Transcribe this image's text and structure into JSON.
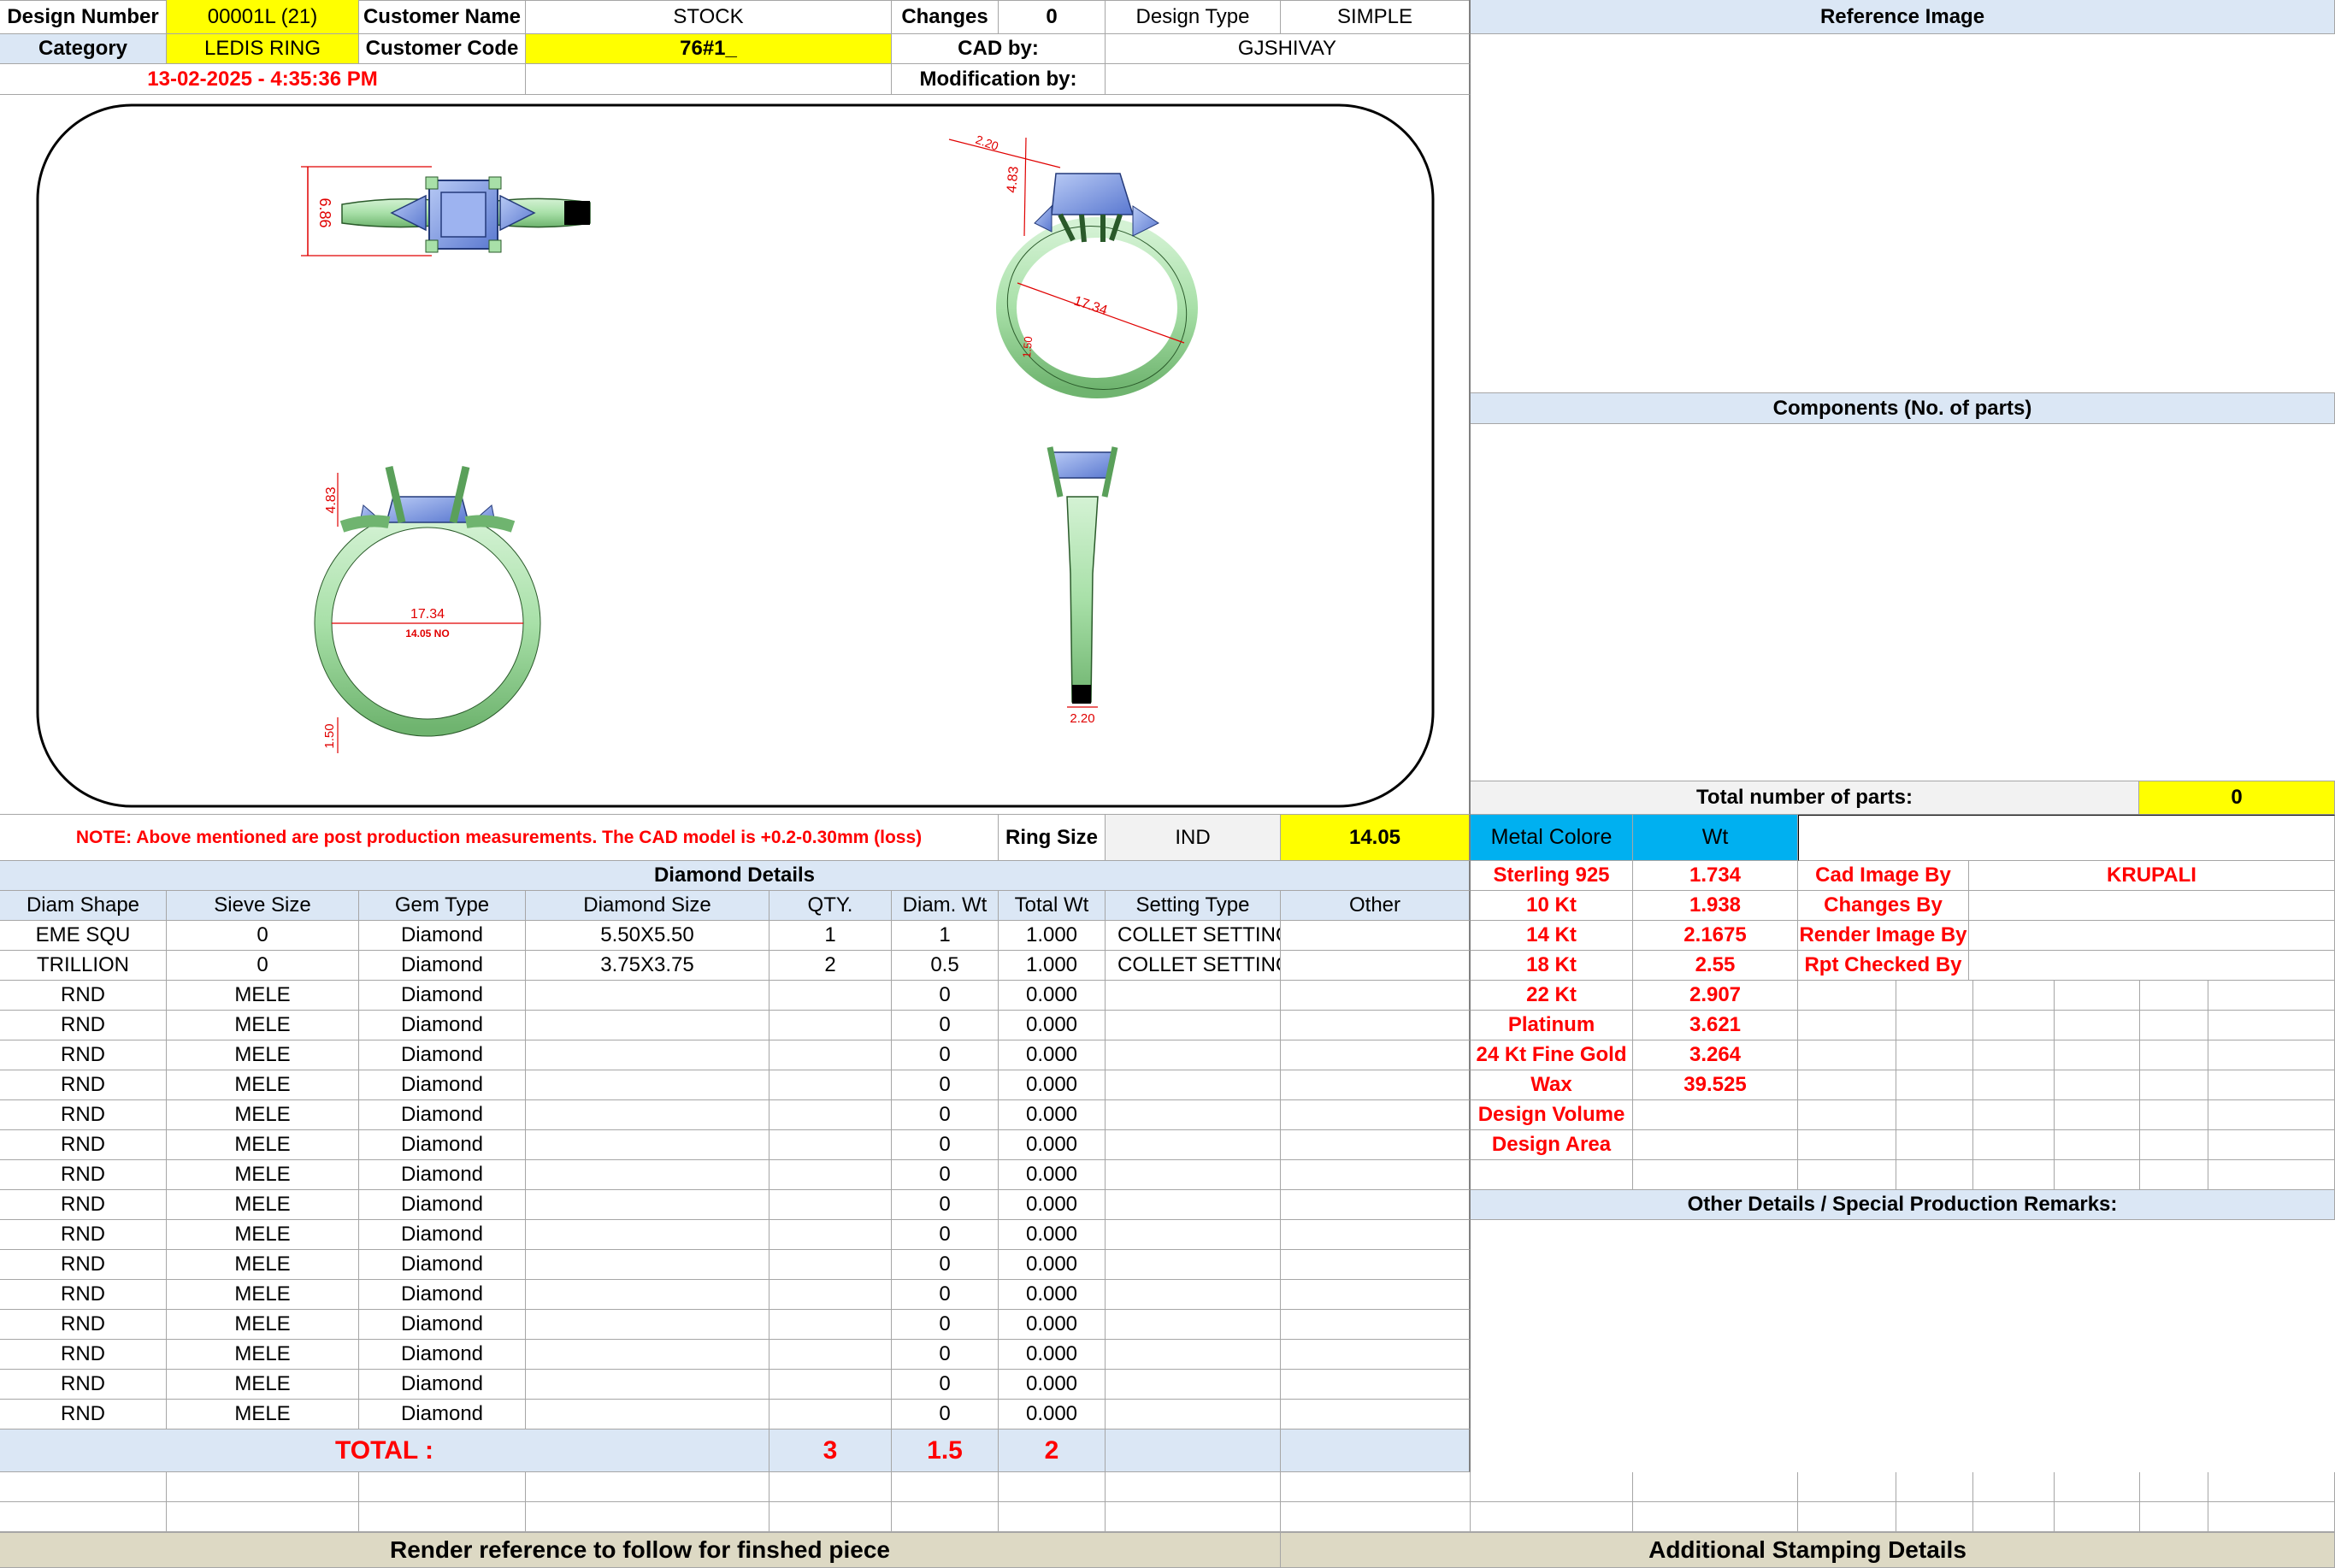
{
  "header": {
    "design_number_label": "Design Number",
    "design_number": "00001L (21)",
    "customer_name_label": "Customer Name",
    "customer_name": "STOCK",
    "changes_label": "Changes",
    "changes": "0",
    "design_type_label": "Design Type",
    "design_type": "SIMPLE",
    "category_label": "Category",
    "category": "LEDIS RING",
    "customer_code_label": "Customer Code",
    "customer_code": "76#1_",
    "cad_by_label": "CAD by:",
    "cad_by": "GJSHIVAY",
    "datetime": "13-02-2025 - 4:35:36 PM",
    "modification_by_label": "Modification by:",
    "modification_by": ""
  },
  "drawing": {
    "top_view_width": "6.86",
    "perspective_height": "4.83",
    "perspective_band_width": "2.20",
    "perspective_inner": "17.34",
    "perspective_thickness": "1.50",
    "front_height": "4.83",
    "front_inner": "17.34",
    "front_ring_size": "14.05 NO",
    "front_thickness": "1.50",
    "side_band_width": "2.20"
  },
  "note": "NOTE: Above mentioned are post production measurements. The CAD model is +0.2-0.30mm (loss)",
  "ring_size": {
    "label": "Ring Size",
    "standard": "IND",
    "value": "14.05"
  },
  "diamond_details": {
    "title": "Diamond Details",
    "columns": [
      "Diam Shape",
      "Sieve Size",
      "Gem Type",
      "Diamond Size",
      "QTY.",
      "Diam. Wt",
      "Total Wt",
      "Setting Type",
      "Other"
    ],
    "rows": [
      [
        "EME SQU",
        "0",
        "Diamond",
        "5.50X5.50",
        "1",
        "1",
        "1.000",
        "COLLET SETTING",
        ""
      ],
      [
        "TRILLION",
        "0",
        "Diamond",
        "3.75X3.75",
        "2",
        "0.5",
        "1.000",
        "COLLET SETTING",
        ""
      ],
      [
        "RND",
        "MELE",
        "Diamond",
        "",
        "",
        "0",
        "0.000",
        "",
        ""
      ],
      [
        "RND",
        "MELE",
        "Diamond",
        "",
        "",
        "0",
        "0.000",
        "",
        ""
      ],
      [
        "RND",
        "MELE",
        "Diamond",
        "",
        "",
        "0",
        "0.000",
        "",
        ""
      ],
      [
        "RND",
        "MELE",
        "Diamond",
        "",
        "",
        "0",
        "0.000",
        "",
        ""
      ],
      [
        "RND",
        "MELE",
        "Diamond",
        "",
        "",
        "0",
        "0.000",
        "",
        ""
      ],
      [
        "RND",
        "MELE",
        "Diamond",
        "",
        "",
        "0",
        "0.000",
        "",
        ""
      ],
      [
        "RND",
        "MELE",
        "Diamond",
        "",
        "",
        "0",
        "0.000",
        "",
        ""
      ],
      [
        "RND",
        "MELE",
        "Diamond",
        "",
        "",
        "0",
        "0.000",
        "",
        ""
      ],
      [
        "RND",
        "MELE",
        "Diamond",
        "",
        "",
        "0",
        "0.000",
        "",
        ""
      ],
      [
        "RND",
        "MELE",
        "Diamond",
        "",
        "",
        "0",
        "0.000",
        "",
        ""
      ],
      [
        "RND",
        "MELE",
        "Diamond",
        "",
        "",
        "0",
        "0.000",
        "",
        ""
      ],
      [
        "RND",
        "MELE",
        "Diamond",
        "",
        "",
        "0",
        "0.000",
        "",
        ""
      ],
      [
        "RND",
        "MELE",
        "Diamond",
        "",
        "",
        "0",
        "0.000",
        "",
        ""
      ],
      [
        "RND",
        "MELE",
        "Diamond",
        "",
        "",
        "0",
        "0.000",
        "",
        ""
      ],
      [
        "RND",
        "MELE",
        "Diamond",
        "",
        "",
        "0",
        "0.000",
        "",
        ""
      ]
    ],
    "total_label": "TOTAL :",
    "total_qty": "3",
    "total_diam_wt": "1.5",
    "total_wt": "2"
  },
  "right_panel": {
    "reference_image": "Reference Image",
    "components": "Components (No. of parts)",
    "total_parts_label": "Total number of parts:",
    "total_parts": "0",
    "metal_color_label": "Metal Colore",
    "wt_label": "Wt",
    "metals": [
      {
        "name": "Sterling 925",
        "wt": "1.734"
      },
      {
        "name": "10 Kt",
        "wt": "1.938"
      },
      {
        "name": "14 Kt",
        "wt": "2.1675"
      },
      {
        "name": "18 Kt",
        "wt": "2.55"
      },
      {
        "name": "22 Kt",
        "wt": "2.907"
      },
      {
        "name": "Platinum",
        "wt": "3.621"
      },
      {
        "name": "24 Kt Fine Gold",
        "wt": "3.264"
      },
      {
        "name": "Wax",
        "wt": "39.525"
      },
      {
        "name": "Design Volume",
        "wt": ""
      },
      {
        "name": "Design Area",
        "wt": ""
      }
    ],
    "credits": [
      {
        "label": "Cad Image By",
        "value": "KRUPALI"
      },
      {
        "label": "Changes By",
        "value": ""
      },
      {
        "label": "Render Image By",
        "value": ""
      },
      {
        "label": "Rpt Checked By",
        "value": ""
      }
    ],
    "other_details": "Other Details / Special Production Remarks:"
  },
  "footer": {
    "render_reference": "Render reference to follow for finshed piece",
    "stamping": "Additional Stamping Details"
  },
  "colors": {
    "yellow": "#ffff00",
    "header_blue": "#dbe7f5",
    "metal_header": "#00b0f0",
    "footer_tan": "#ddd9c4",
    "label_red": "#ff0000",
    "metal_green": "#a8e0a8",
    "stone_blue": "#7a98e8"
  }
}
